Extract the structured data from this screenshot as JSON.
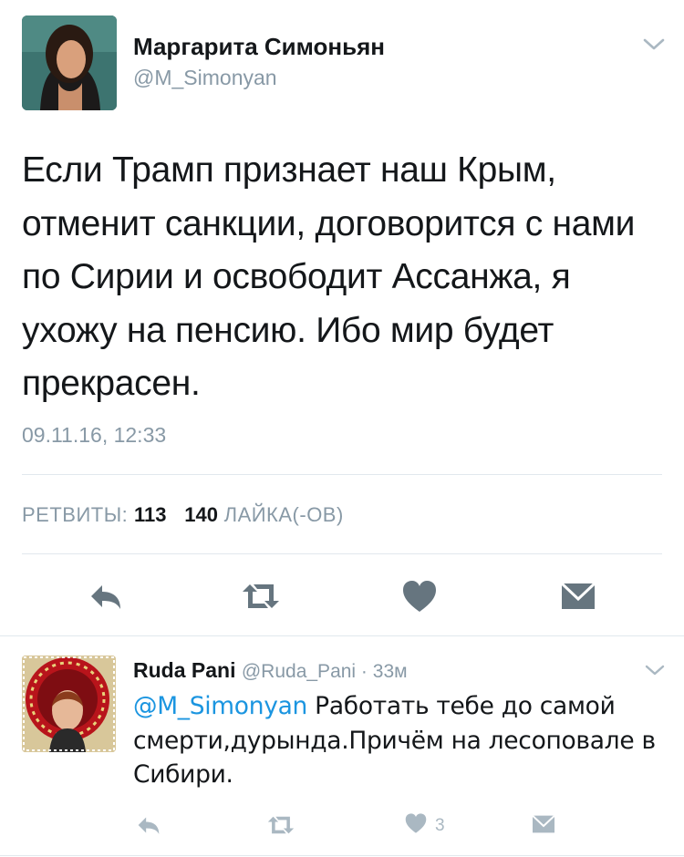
{
  "main_tweet": {
    "author_name": "Маргарита Симоньян",
    "handle": "@M_Simonyan",
    "text": "Если Трамп признает наш Крым, отменит санкции, договорится с нами по Сирии и освободит Ассанжа, я ухожу на пенсию. Ибо мир будет прекрасен.",
    "timestamp": "09.11.16, 12:33",
    "retweets_label": "РЕТВИТЫ:",
    "retweets_count": "113",
    "likes_count": "140",
    "likes_label": "ЛАЙКА(-ОВ)"
  },
  "actions": {
    "icons": [
      "reply-icon",
      "retweet-icon",
      "like-icon",
      "message-icon"
    ],
    "color": "#66757f"
  },
  "reply_tweet": {
    "author_name": "Ruda Pani",
    "handle": "@Ruda_Pani",
    "separator": " · ",
    "time": "33м",
    "mention": "@M_Simonyan",
    "text": " Работать тебе до самой смерти,дурында.Причём на лесоповале в Сибири.",
    "like_count": "3",
    "icon_color": "#aab8c2"
  },
  "colors": {
    "text": "#14171a",
    "muted": "#8899a6",
    "link": "#1b95e0",
    "divider": "#e1e8ed"
  }
}
